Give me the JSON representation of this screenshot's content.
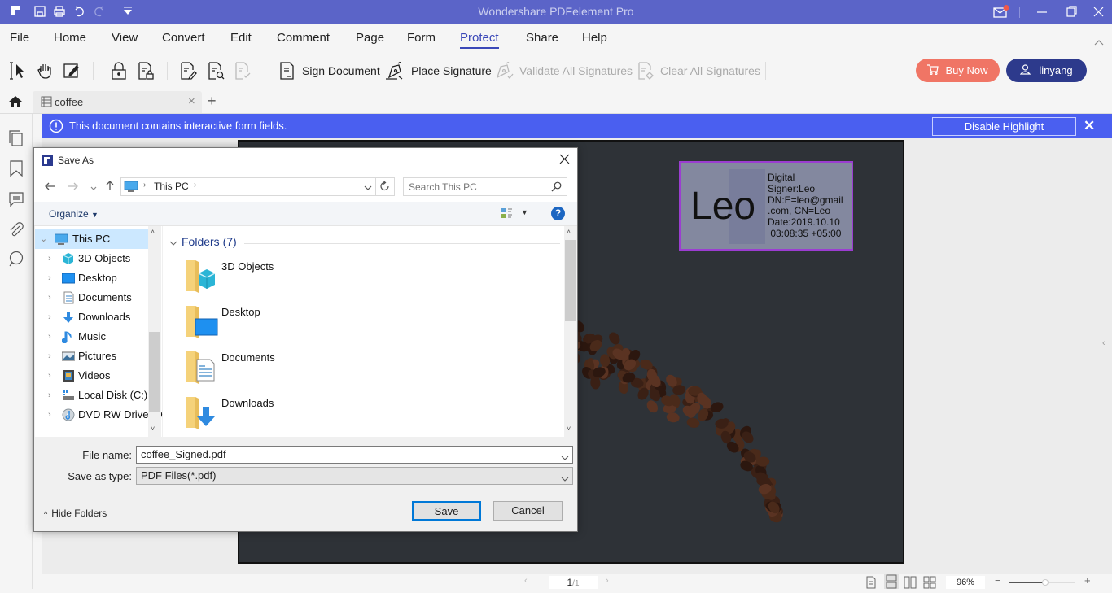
{
  "app": {
    "title": "Wondershare PDFelement Pro",
    "quick_access": [
      "logo-icon",
      "save-icon",
      "print-icon",
      "undo-icon",
      "redo-icon",
      "customize-icon"
    ]
  },
  "menu": {
    "items": [
      "File",
      "Home",
      "View",
      "Convert",
      "Edit",
      "Comment",
      "Page",
      "Form",
      "Protect",
      "Share",
      "Help"
    ],
    "active": "Protect"
  },
  "toolbar": {
    "sign_document": "Sign Document",
    "place_signature": "Place Signature",
    "validate_all": "Validate All Signatures",
    "clear_all": "Clear All Signatures",
    "buy_now": "Buy Now",
    "user": "linyang"
  },
  "tabs": {
    "doc_tab": "coffee",
    "add_tab": "+",
    "close": "×"
  },
  "banner": {
    "message": "This document contains interactive form fields.",
    "button": "Disable Highlight",
    "close": "✕"
  },
  "signature": {
    "name": "Leo",
    "info": "Digital\nSigner:Leo\nDN:E=leo@gmail\n.com, CN=Leo\nDate:2019.10.10\n 03:08:35 +05:00"
  },
  "status": {
    "page_current": "1",
    "page_total": "/1",
    "zoom": "96%",
    "zoom_slider_fraction": 0.55
  },
  "dialog": {
    "title": "Save As",
    "breadcrumb": [
      "This PC"
    ],
    "search_placeholder": "Search This PC",
    "organize": "Organize",
    "nav_tree": [
      {
        "label": "This PC",
        "icon": "pc-icon",
        "expanded": true,
        "selected": true
      },
      {
        "label": "3D Objects",
        "icon": "3d-objects-icon"
      },
      {
        "label": "Desktop",
        "icon": "desktop-icon"
      },
      {
        "label": "Documents",
        "icon": "documents-icon"
      },
      {
        "label": "Downloads",
        "icon": "downloads-icon"
      },
      {
        "label": "Music",
        "icon": "music-icon"
      },
      {
        "label": "Pictures",
        "icon": "pictures-icon"
      },
      {
        "label": "Videos",
        "icon": "videos-icon"
      },
      {
        "label": "Local Disk (C:)",
        "icon": "disk-icon"
      },
      {
        "label": "DVD RW Drive (D",
        "icon": "dvd-icon"
      }
    ],
    "group_header": "Folders (7)",
    "folders": [
      "3D Objects",
      "Desktop",
      "Documents",
      "Downloads"
    ],
    "file_name_label": "File name:",
    "file_name": "coffee_Signed.pdf",
    "save_type_label": "Save as type:",
    "save_type": "PDF Files(*.pdf)",
    "hide_folders": "Hide Folders",
    "save": "Save",
    "cancel": "Cancel"
  }
}
